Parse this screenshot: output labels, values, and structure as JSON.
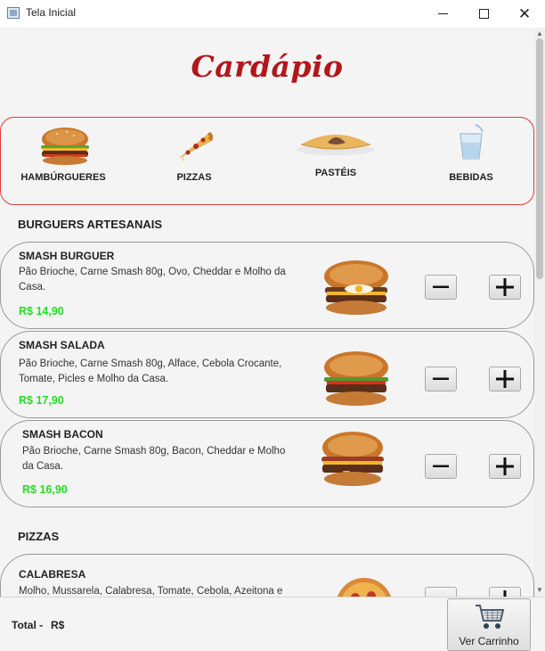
{
  "window": {
    "title": "Tela Inicial"
  },
  "header": {
    "logo_text": "Cardápio"
  },
  "categories": [
    {
      "label": "HAMBÚRGUERES",
      "icon": "burger-icon"
    },
    {
      "label": "PIZZAS",
      "icon": "pizza-slice-icon"
    },
    {
      "label": "PASTÉIS",
      "icon": "pastel-icon"
    },
    {
      "label": "BEBIDAS",
      "icon": "water-glass-icon"
    }
  ],
  "sections": [
    {
      "title": "BURGUERS ARTESANAIS",
      "items": [
        {
          "name": "SMASH BURGUER",
          "description": "Pão Brioche, Carne Smash 80g, Ovo, Cheddar e Molho da Casa.",
          "price": "R$ 14,90",
          "image": "smash-burguer-image"
        },
        {
          "name": "SMASH SALADA",
          "description": "Pão Brioche, Carne Smash 80g, Alface, Cebola Crocante, Tomate, Picles e Molho da Casa.",
          "price": "R$ 17,90",
          "image": "smash-salada-image"
        },
        {
          "name": "SMASH BACON",
          "description": "Pão Brioche, Carne Smash 80g, Bacon, Cheddar e Molho da Casa.",
          "price": "R$ 16,90",
          "image": "smash-bacon-image"
        }
      ]
    },
    {
      "title": "PIZZAS",
      "items": [
        {
          "name": "CALABRESA",
          "description": "Molho, Mussarela, Calabresa, Tomate, Cebola, Azeitona e",
          "price": "",
          "image": "calabresa-pizza-image"
        }
      ]
    }
  ],
  "footer": {
    "total_label": "Total -",
    "total_value": "R$",
    "cart_button_label": "Ver Carrinho"
  },
  "colors": {
    "brand": "#b3161b",
    "category_border": "#e03b3b",
    "price": "#1ee21e"
  }
}
